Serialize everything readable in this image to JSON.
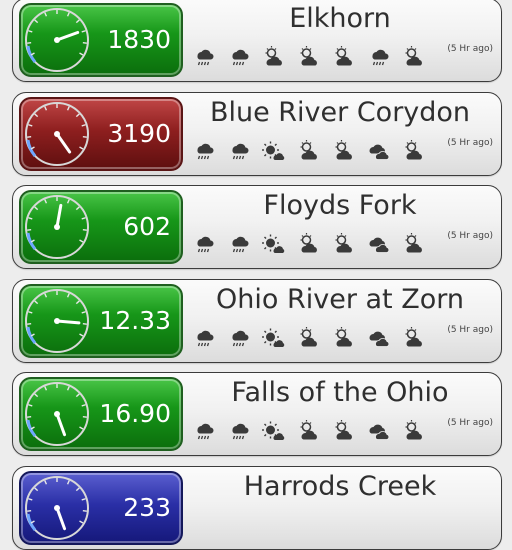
{
  "gauges": [
    {
      "name": "Elkhorn",
      "reading": "1830",
      "status": "green",
      "needle_angle": 70,
      "updated": "(5 Hr ago)",
      "forecast": [
        "rain-icon",
        "rain-icon",
        "partly-cloudy-icon",
        "partly-cloudy-icon",
        "partly-cloudy-icon",
        "rain-icon",
        "partly-cloudy-icon"
      ]
    },
    {
      "name": "Blue River Corydon",
      "reading": "3190",
      "status": "red",
      "needle_angle": 145,
      "updated": "(5 Hr ago)",
      "forecast": [
        "rain-icon",
        "rain-icon",
        "sunny-icon",
        "partly-cloudy-icon",
        "partly-cloudy-icon",
        "cloudy-icon",
        "partly-cloudy-icon"
      ]
    },
    {
      "name": "Floyds Fork",
      "reading": "602",
      "status": "green",
      "needle_angle": 10,
      "updated": "(5 Hr ago)",
      "forecast": [
        "rain-icon",
        "rain-icon",
        "sunny-icon",
        "partly-cloudy-icon",
        "partly-cloudy-icon",
        "cloudy-icon",
        "partly-cloudy-icon"
      ]
    },
    {
      "name": "Ohio River at Zorn",
      "reading": "12.33",
      "status": "green",
      "needle_angle": 95,
      "updated": "(5 Hr ago)",
      "forecast": [
        "rain-icon",
        "rain-icon",
        "sunny-icon",
        "partly-cloudy-icon",
        "partly-cloudy-icon",
        "cloudy-icon",
        "partly-cloudy-icon"
      ]
    },
    {
      "name": "Falls of the Ohio",
      "reading": "16.90",
      "status": "green",
      "needle_angle": 160,
      "updated": "(5 Hr ago)",
      "forecast": [
        "rain-icon",
        "rain-icon",
        "sunny-icon",
        "partly-cloudy-icon",
        "partly-cloudy-icon",
        "cloudy-icon",
        "partly-cloudy-icon"
      ]
    },
    {
      "name": "Harrods Creek",
      "reading": "233",
      "status": "blue",
      "needle_angle": 160,
      "updated": "",
      "forecast": []
    }
  ],
  "colors": {
    "green": "#179719",
    "red": "#8e1f1f",
    "blue": "#2a2fa6"
  }
}
